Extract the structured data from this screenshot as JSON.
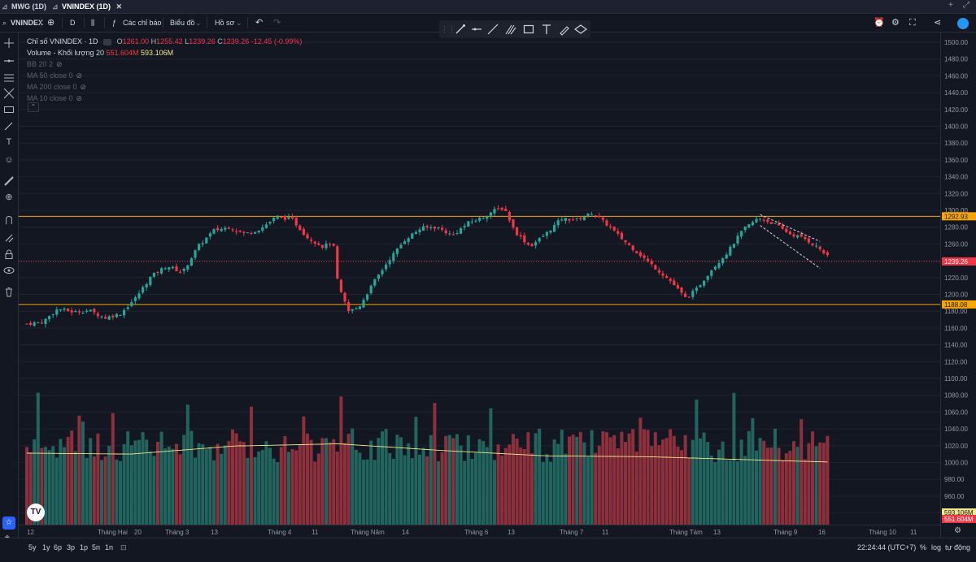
{
  "tabs": [
    {
      "label": "MWG (1D)",
      "active": false
    },
    {
      "label": "VNINDEX (1D)",
      "active": true
    }
  ],
  "toolbar": {
    "symbol": "VNINDEX",
    "interval": "D",
    "indicators_label": "Các chỉ báo",
    "chart_label": "Biểu đồ",
    "profile_label": "Hồ sơ"
  },
  "legend": {
    "title": "Chỉ số VNINDEX · 1D",
    "open_label": "O",
    "open": "1261.00",
    "high_label": "H",
    "high": "1255.42",
    "low_label": "L",
    "low": "1239.26",
    "close_label": "C",
    "close": "1239.26",
    "change": "-12.45 (-0.99%)",
    "volume_label": "Volume - Khối lượng 20",
    "volume_value": "551.604M",
    "volume_ma": "593.106M",
    "indicators": [
      "BB 20 2",
      "MA 50 close 0",
      "MA 200 close 0",
      "MA 10 close 0"
    ]
  },
  "price_axis": {
    "ticks": [
      "1500.00",
      "1480.00",
      "1460.00",
      "1440.00",
      "1420.00",
      "1400.00",
      "1380.00",
      "1360.00",
      "1340.00",
      "1320.00",
      "1300.00",
      "1280.00",
      "1260.00",
      "1240.00",
      "1220.00",
      "1200.00",
      "1180.00",
      "1160.00",
      "1140.00",
      "1120.00",
      "1100.00",
      "1080.00",
      "1060.00",
      "1040.00",
      "1020.00",
      "1000.00",
      "980.00",
      "960.00",
      "940.00"
    ],
    "labels": [
      {
        "text": "1292.93",
        "color": "#f7a600",
        "text_color": "#131722"
      },
      {
        "text": "1239.26",
        "color": "#f23645",
        "text_color": "#ffffff"
      },
      {
        "text": "1188.08",
        "color": "#f7a600",
        "text_color": "#131722"
      },
      {
        "text": "593.106M",
        "color": "#f0e68c",
        "text_color": "#131722"
      },
      {
        "text": "551.604M",
        "color": "#f23645",
        "text_color": "#ffffff"
      }
    ]
  },
  "time_axis": [
    "12",
    "Tháng Hai",
    "20",
    "Tháng 3",
    "13",
    "Tháng 4",
    "11",
    "Tháng Năm",
    "14",
    "Tháng 6",
    "13",
    "Tháng 7",
    "11",
    "Tháng Tám",
    "13",
    "Tháng 9",
    "16",
    "Tháng 10",
    "11"
  ],
  "bottom": {
    "ranges": [
      "5y",
      "1y",
      "6p",
      "3p",
      "1p",
      "5n",
      "1n"
    ],
    "clock": "22:24:44 (UTC+7)",
    "pct": "%",
    "log": "log",
    "auto": "tự động"
  },
  "colors": {
    "up": "#26a69a",
    "down": "#f23645",
    "vol_up": "#22645e",
    "vol_down": "#8e2f3c",
    "ma": "#f0e68c",
    "hline": "#f7a600"
  },
  "chart_data": {
    "type": "candlestick",
    "symbol": "VNINDEX",
    "interval": "1D",
    "ylim": [
      930,
      1510
    ],
    "hlines": [
      1292.93,
      1188.08
    ],
    "last_price": 1239.26,
    "trendlines": [
      {
        "from": [
          196,
          1295
        ],
        "to": [
          212,
          1263
        ]
      },
      {
        "from": [
          196,
          1282
        ],
        "to": [
          212,
          1231
        ]
      }
    ],
    "close_path": [
      [
        0,
        1165
      ],
      [
        6,
        1167
      ],
      [
        12,
        1183
      ],
      [
        18,
        1179
      ],
      [
        24,
        1181
      ],
      [
        30,
        1172
      ],
      [
        36,
        1177
      ],
      [
        42,
        1196
      ],
      [
        48,
        1222
      ],
      [
        54,
        1234
      ],
      [
        60,
        1226
      ],
      [
        66,
        1257
      ],
      [
        72,
        1276
      ],
      [
        78,
        1280
      ],
      [
        84,
        1272
      ],
      [
        90,
        1278
      ],
      [
        96,
        1292
      ],
      [
        102,
        1290
      ],
      [
        108,
        1268
      ],
      [
        114,
        1257
      ],
      [
        118,
        1262
      ],
      [
        120,
        1209
      ],
      [
        124,
        1180
      ],
      [
        128,
        1185
      ],
      [
        134,
        1216
      ],
      [
        140,
        1243
      ],
      [
        146,
        1266
      ],
      [
        152,
        1279
      ],
      [
        158,
        1280
      ],
      [
        164,
        1270
      ],
      [
        170,
        1285
      ],
      [
        176,
        1292
      ],
      [
        180,
        1300
      ],
      [
        184,
        1303
      ],
      [
        188,
        1275
      ],
      [
        194,
        1257
      ],
      [
        200,
        1272
      ],
      [
        206,
        1290
      ],
      [
        212,
        1289
      ],
      [
        218,
        1297
      ],
      [
        224,
        1282
      ],
      [
        230,
        1264
      ],
      [
        236,
        1248
      ],
      [
        242,
        1232
      ],
      [
        248,
        1216
      ],
      [
        254,
        1195
      ],
      [
        258,
        1206
      ],
      [
        264,
        1230
      ],
      [
        270,
        1250
      ],
      [
        276,
        1277
      ],
      [
        282,
        1291
      ],
      [
        288,
        1284
      ],
      [
        294,
        1272
      ],
      [
        300,
        1266
      ],
      [
        306,
        1253
      ],
      [
        310,
        1240
      ]
    ],
    "volume": {
      "range": [
        0,
        1250
      ],
      "ma20_path": [
        [
          0,
          800
        ],
        [
          40,
          790
        ],
        [
          80,
          880
        ],
        [
          120,
          905
        ],
        [
          160,
          830
        ],
        [
          200,
          770
        ],
        [
          240,
          760
        ],
        [
          280,
          725
        ],
        [
          310,
          700
        ]
      ],
      "last": 551.604,
      "ma_last": 593.106
    }
  }
}
